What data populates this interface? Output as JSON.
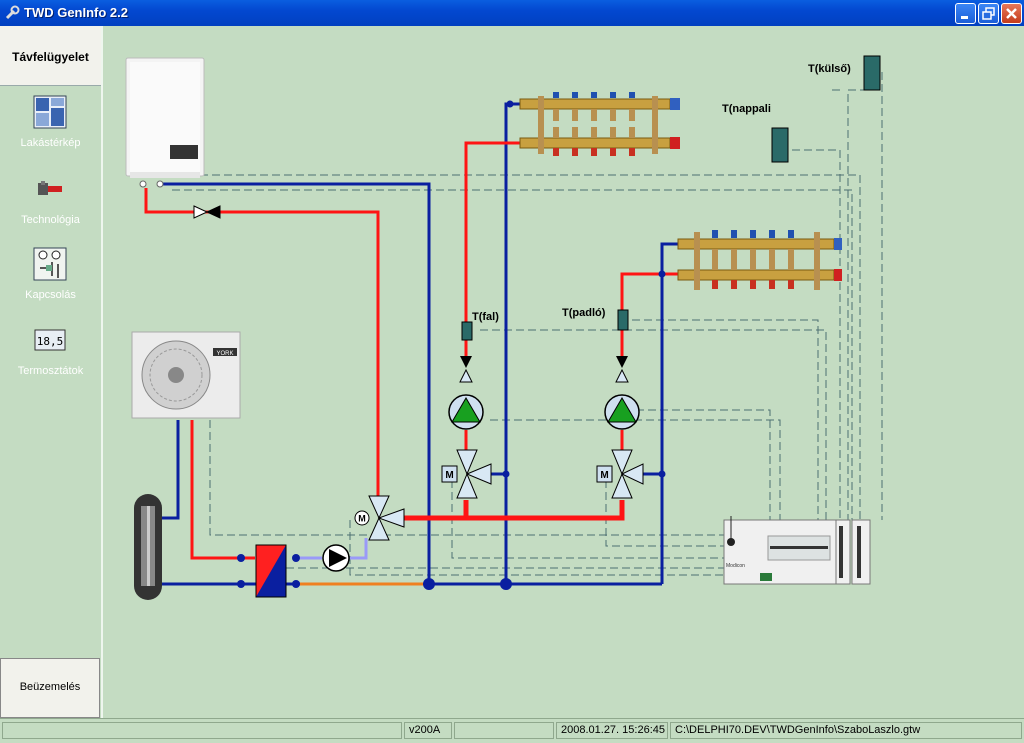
{
  "window": {
    "title": "TWD GenInfo 2.2"
  },
  "sidebar": {
    "active_tab": "Távfelügyelet",
    "items": [
      {
        "label": "Lakástérkép",
        "icon": "floor-plan-icon"
      },
      {
        "label": "Technológia",
        "icon": "technology-icon"
      },
      {
        "label": "Kapcsolás",
        "icon": "wiring-icon"
      },
      {
        "label": "Termosztátok",
        "icon": "thermostat-icon"
      }
    ],
    "bottom_button": "Beüzemelés"
  },
  "diagram": {
    "labels": {
      "t_kulso": "T(külső)",
      "t_nappali": "T(nappali",
      "t_fal": "T(fal)",
      "t_padlo": "T(padló)",
      "york": "YORK",
      "plc_brand": "Modicon"
    },
    "colors": {
      "supply": "#ff1414",
      "return": "#0a1fa0",
      "signal": "#4a6a6a",
      "pump": "#18a020"
    }
  },
  "statusbar": {
    "panel1": "",
    "version": "v200A",
    "panel3": "",
    "datetime": "2008.01.27. 15:26:45",
    "path": "C:\\DELPHI70.DEV\\TWDGenInfo\\SzaboLaszlo.gtw"
  }
}
